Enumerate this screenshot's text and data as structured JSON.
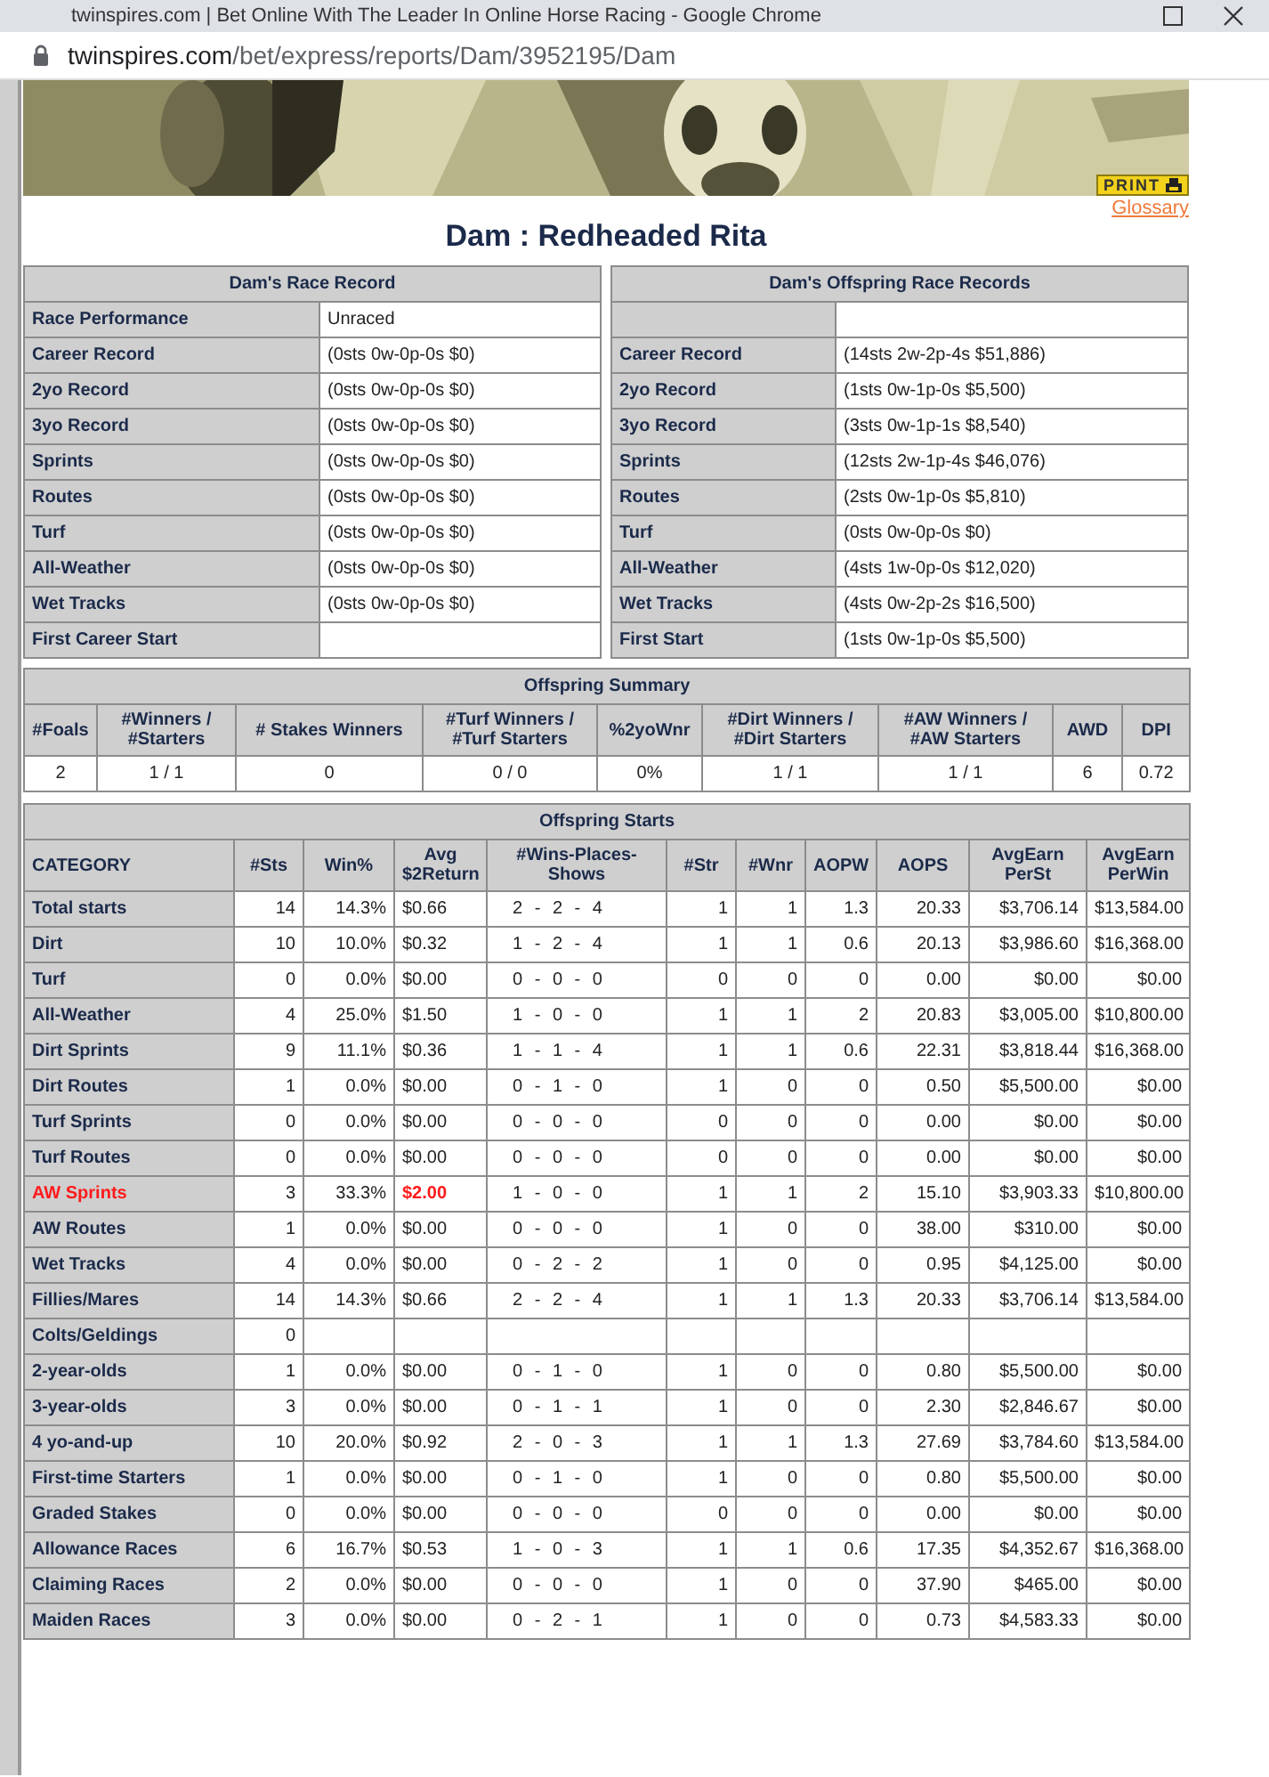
{
  "browser": {
    "title": "twinspires.com | Bet Online With The Leader In Online Horse Racing - Google Chrome",
    "url_host": "twinspires.com",
    "url_path": "/bet/express/reports/Dam/3952195/Dam"
  },
  "banner": {
    "kind": "picture",
    "print_button": "PRINT"
  },
  "glossary_link": "Glossary",
  "heading": "Dam : Redheaded Rita",
  "dam_race_record": {
    "title": "Dam's Race Record",
    "rows": [
      {
        "label": "Race Performance",
        "value": "Unraced"
      },
      {
        "label": "Career Record",
        "value": "(0sts 0w-0p-0s $0)"
      },
      {
        "label": "2yo Record",
        "value": "(0sts 0w-0p-0s $0)"
      },
      {
        "label": "3yo Record",
        "value": "(0sts 0w-0p-0s $0)"
      },
      {
        "label": "Sprints",
        "value": "(0sts 0w-0p-0s $0)"
      },
      {
        "label": "Routes",
        "value": "(0sts 0w-0p-0s $0)"
      },
      {
        "label": "Turf",
        "value": "(0sts 0w-0p-0s $0)"
      },
      {
        "label": "All-Weather",
        "value": "(0sts 0w-0p-0s $0)"
      },
      {
        "label": "Wet Tracks",
        "value": "(0sts 0w-0p-0s $0)"
      },
      {
        "label": "First Career Start"
      }
    ]
  },
  "offspring_race_records": {
    "title": "Dam's Offspring Race Records",
    "rows": [
      {},
      {
        "label": "Career Record",
        "value": "(14sts 2w-2p-4s $51,886)"
      },
      {
        "label": "2yo Record",
        "value": "(1sts 0w-1p-0s $5,500)"
      },
      {
        "label": "3yo Record",
        "value": "(3sts 0w-1p-1s $8,540)"
      },
      {
        "label": "Sprints",
        "value": "(12sts 2w-1p-4s $46,076)"
      },
      {
        "label": "Routes",
        "value": "(2sts 0w-1p-0s $5,810)"
      },
      {
        "label": "Turf",
        "value": "(0sts 0w-0p-0s $0)"
      },
      {
        "label": "All-Weather",
        "value": "(4sts 1w-0p-0s $12,020)"
      },
      {
        "label": "Wet Tracks",
        "value": "(4sts 0w-2p-2s $16,500)"
      },
      {
        "label": "First Start",
        "value": "(1sts 0w-1p-0s $5,500)"
      }
    ]
  },
  "offspring_summary": {
    "title": "Offspring Summary",
    "columns": [
      "#Foals",
      "#Winners / #Starters",
      "# Stakes Winners",
      "#Turf Winners / #Turf Starters",
      "%2yoWnr",
      "#Dirt Winners / #Dirt Starters",
      "#AW Winners / #AW Starters",
      "AWD",
      "DPI"
    ],
    "values": [
      "2",
      "1 / 1",
      "0",
      "0 / 0",
      "0%",
      "1 / 1",
      "1 / 1",
      "6",
      "0.72"
    ]
  },
  "offspring_starts": {
    "title": "Offspring Starts",
    "columns": [
      "CATEGORY",
      "#Sts",
      "Win%",
      "Avg $2Return",
      "#Wins-Places-Shows",
      "#Str",
      "#Wnr",
      "AOPW",
      "AOPS",
      "AvgEarn PerSt",
      "AvgEarn PerWin"
    ],
    "rows": [
      {
        "highlight": false,
        "cells": [
          "Total starts",
          "14",
          "14.3%",
          "$0.66",
          "2 - 2 - 4",
          "1",
          "1",
          "1.3",
          "20.33",
          "$3,706.14",
          "$13,584.00"
        ]
      },
      {
        "highlight": false,
        "cells": [
          "Dirt",
          "10",
          "10.0%",
          "$0.32",
          "1 - 2 - 4",
          "1",
          "1",
          "0.6",
          "20.13",
          "$3,986.60",
          "$16,368.00"
        ]
      },
      {
        "highlight": false,
        "cells": [
          "Turf",
          "0",
          "0.0%",
          "$0.00",
          "0 - 0 - 0",
          "0",
          "0",
          "0",
          "0.00",
          "$0.00",
          "$0.00"
        ]
      },
      {
        "highlight": false,
        "cells": [
          "All-Weather",
          "4",
          "25.0%",
          "$1.50",
          "1 - 0 - 0",
          "1",
          "1",
          "2",
          "20.83",
          "$3,005.00",
          "$10,800.00"
        ]
      },
      {
        "highlight": false,
        "cells": [
          "Dirt Sprints",
          "9",
          "11.1%",
          "$0.36",
          "1 - 1 - 4",
          "1",
          "1",
          "0.6",
          "22.31",
          "$3,818.44",
          "$16,368.00"
        ]
      },
      {
        "highlight": false,
        "cells": [
          "Dirt Routes",
          "1",
          "0.0%",
          "$0.00",
          "0 - 1 - 0",
          "1",
          "0",
          "0",
          "0.50",
          "$5,500.00",
          "$0.00"
        ]
      },
      {
        "highlight": false,
        "cells": [
          "Turf Sprints",
          "0",
          "0.0%",
          "$0.00",
          "0 - 0 - 0",
          "0",
          "0",
          "0",
          "0.00",
          "$0.00",
          "$0.00"
        ]
      },
      {
        "highlight": false,
        "cells": [
          "Turf Routes",
          "0",
          "0.0%",
          "$0.00",
          "0 - 0 - 0",
          "0",
          "0",
          "0",
          "0.00",
          "$0.00",
          "$0.00"
        ]
      },
      {
        "highlight": true,
        "cells": [
          "AW Sprints",
          "3",
          "33.3%",
          "$2.00",
          "1 - 0 - 0",
          "1",
          "1",
          "2",
          "15.10",
          "$3,903.33",
          "$10,800.00"
        ]
      },
      {
        "highlight": false,
        "cells": [
          "AW Routes",
          "1",
          "0.0%",
          "$0.00",
          "0 - 0 - 0",
          "1",
          "0",
          "0",
          "38.00",
          "$310.00",
          "$0.00"
        ]
      },
      {
        "highlight": false,
        "cells": [
          "Wet Tracks",
          "4",
          "0.0%",
          "$0.00",
          "0 - 2 - 2",
          "1",
          "0",
          "0",
          "0.95",
          "$4,125.00",
          "$0.00"
        ]
      },
      {
        "highlight": false,
        "cells": [
          "Fillies/Mares",
          "14",
          "14.3%",
          "$0.66",
          "2 - 2 - 4",
          "1",
          "1",
          "1.3",
          "20.33",
          "$3,706.14",
          "$13,584.00"
        ]
      },
      {
        "highlight": false,
        "cells": [
          "Colts/Geldings",
          "0"
        ]
      },
      {
        "highlight": false,
        "cells": [
          "2-year-olds",
          "1",
          "0.0%",
          "$0.00",
          "0 - 1 - 0",
          "1",
          "0",
          "0",
          "0.80",
          "$5,500.00",
          "$0.00"
        ]
      },
      {
        "highlight": false,
        "cells": [
          "3-year-olds",
          "3",
          "0.0%",
          "$0.00",
          "0 - 1 - 1",
          "1",
          "0",
          "0",
          "2.30",
          "$2,846.67",
          "$0.00"
        ]
      },
      {
        "highlight": false,
        "cells": [
          "4 yo-and-up",
          "10",
          "20.0%",
          "$0.92",
          "2 - 0 - 3",
          "1",
          "1",
          "1.3",
          "27.69",
          "$3,784.60",
          "$13,584.00"
        ]
      },
      {
        "highlight": false,
        "cells": [
          "First-time Starters",
          "1",
          "0.0%",
          "$0.00",
          "0 - 1 - 0",
          "1",
          "0",
          "0",
          "0.80",
          "$5,500.00",
          "$0.00"
        ]
      },
      {
        "highlight": false,
        "cells": [
          "Graded Stakes",
          "0",
          "0.0%",
          "$0.00",
          "0 - 0 - 0",
          "0",
          "0",
          "0",
          "0.00",
          "$0.00",
          "$0.00"
        ]
      },
      {
        "highlight": false,
        "cells": [
          "Allowance Races",
          "6",
          "16.7%",
          "$0.53",
          "1 - 0 - 3",
          "1",
          "1",
          "0.6",
          "17.35",
          "$4,352.67",
          "$16,368.00"
        ]
      },
      {
        "highlight": false,
        "cells": [
          "Claiming Races",
          "2",
          "0.0%",
          "$0.00",
          "0 - 0 - 0",
          "1",
          "0",
          "0",
          "37.90",
          "$465.00",
          "$0.00"
        ]
      },
      {
        "highlight": false,
        "cells": [
          "Maiden Races",
          "3",
          "0.0%",
          "$0.00",
          "0 - 2 - 1",
          "1",
          "0",
          "0",
          "0.73",
          "$4,583.33",
          "$0.00"
        ]
      }
    ]
  }
}
